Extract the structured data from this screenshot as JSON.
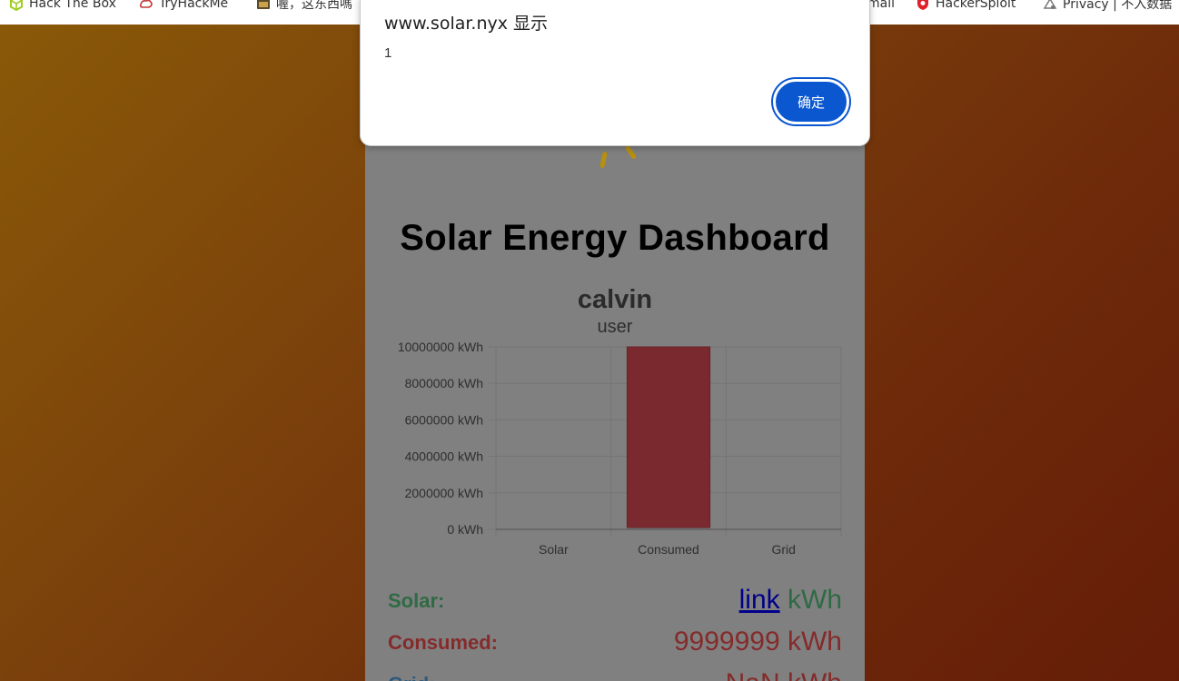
{
  "bookmarks": [
    {
      "label": "Hack The Box",
      "icon": "cube-icon"
    },
    {
      "label": "TryHackMe",
      "icon": "tryhackme-icon"
    },
    {
      "label": "喔，这东西嗎",
      "icon": "folder-icon"
    },
    {
      "label": "mail",
      "icon": "mail-icon"
    },
    {
      "label": "HackerSploit",
      "icon": "shield-icon"
    },
    {
      "label": "Privacy | 不入数据",
      "icon": "privacy-icon"
    }
  ],
  "dialog": {
    "title": "www.solar.nyx 显示",
    "message": "1",
    "ok_label": "确定"
  },
  "page": {
    "title": "Solar Energy Dashboard",
    "username": "calvin",
    "role": "user"
  },
  "chart_data": {
    "type": "bar",
    "categories": [
      "Solar",
      "Consumed",
      "Grid"
    ],
    "values": [
      0,
      9999999,
      0
    ],
    "ylim": [
      0,
      10000000
    ],
    "yticks": [
      "0 kWh",
      "2000000 kWh",
      "4000000 kWh",
      "6000000 kWh",
      "8000000 kWh",
      "10000000 kWh"
    ],
    "grid": true,
    "colors": {
      "Solar": "#3a7a52",
      "Consumed": "#7a2a2e",
      "Grid": "#3a6a8a"
    }
  },
  "stats": {
    "solar": {
      "label": "Solar:",
      "link": "link",
      "unit": "kWh"
    },
    "consumed": {
      "label": "Consumed:",
      "value": "9999999 kWh"
    },
    "grid": {
      "label": "Grid:",
      "value": "NaN kWh"
    }
  }
}
